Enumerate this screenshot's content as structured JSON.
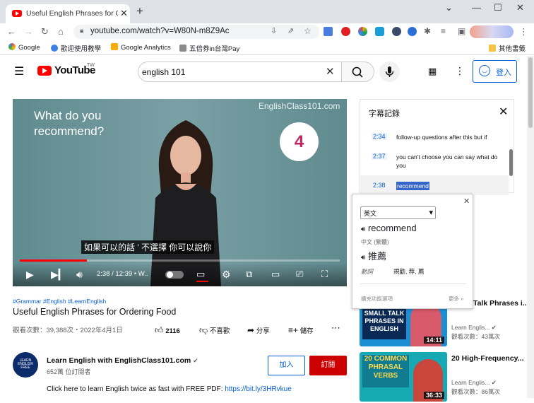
{
  "browser": {
    "tab_title": "Useful English Phrases for Orde",
    "url": "youtube.com/watch?v=W80N-m8Z9Ac",
    "bookmarks": [
      "Google",
      "歡迎使用教學",
      "Google Analytics",
      "五倍券in台灣Pay"
    ],
    "other_bookmarks": "其他書籤"
  },
  "youtube": {
    "logo_text": "YouTube",
    "country": "TW",
    "search_query": "english 101",
    "signin_label": "登入"
  },
  "video": {
    "question": "What do you recommend?",
    "brand": "EnglishClass101.com",
    "number": "4",
    "caption": "如果可以的話 ' 不選擇 你可以說你",
    "time": "2:38 / 12:39",
    "time_suffix": "• W..",
    "progress_fraction": 0.209
  },
  "info": {
    "tags": "#Grammar #English #LearnEnglish",
    "title": "Useful English Phrases for Ordering Food",
    "meta": "觀看次數：39,388次・2022年4月1日",
    "likes": "2116",
    "dislike_label": "不喜歡",
    "share_label": "分享",
    "save_label": "儲存"
  },
  "channel": {
    "avatar_text": "LEARN ENGLISH FREE",
    "name": "Learn English with EnglishClass101.com",
    "subs": "652萬 位訂閱者",
    "join_label": "加入",
    "subscribe_label": "訂閱",
    "description": "Click here to learn English twice as fast with FREE PDF: ",
    "description_link": "https://bit.ly/3HRvkue"
  },
  "transcript": {
    "header": "字幕記錄",
    "rows": [
      {
        "time": "2:34",
        "text": "follow-up questions after this but if"
      },
      {
        "time": "2:37",
        "text": "you can't choose you can say what do you"
      },
      {
        "time": "2:38",
        "text": "recommend"
      }
    ]
  },
  "popup": {
    "language": "英文",
    "word": "recommend",
    "target_lang": "中文 (繁體)",
    "translation": "推薦",
    "pos": "動詞",
    "definitions": "規勸, 荐, 薦",
    "extension_options": "擴充功能選項",
    "more": "更多 »"
  },
  "related": [
    {
      "thumb_text": "SMALL TALK PHRASES IN ENGLISH",
      "title_visible": "Small Talk Phrases i...",
      "channel": "Learn Englis...",
      "meta": "觀看次數：43萬次",
      "duration": "14:11"
    },
    {
      "thumb_text": "20 COMMON PHRASAL VERBS",
      "title_visible": "20 High-Frequency...",
      "channel": "Learn Englis...",
      "meta": "觀看次數：86萬次",
      "duration": "36:33"
    }
  ],
  "colors": {
    "brand_red": "#ff0000",
    "link_blue": "#065fd4",
    "subscribe_red": "#cc0000"
  }
}
